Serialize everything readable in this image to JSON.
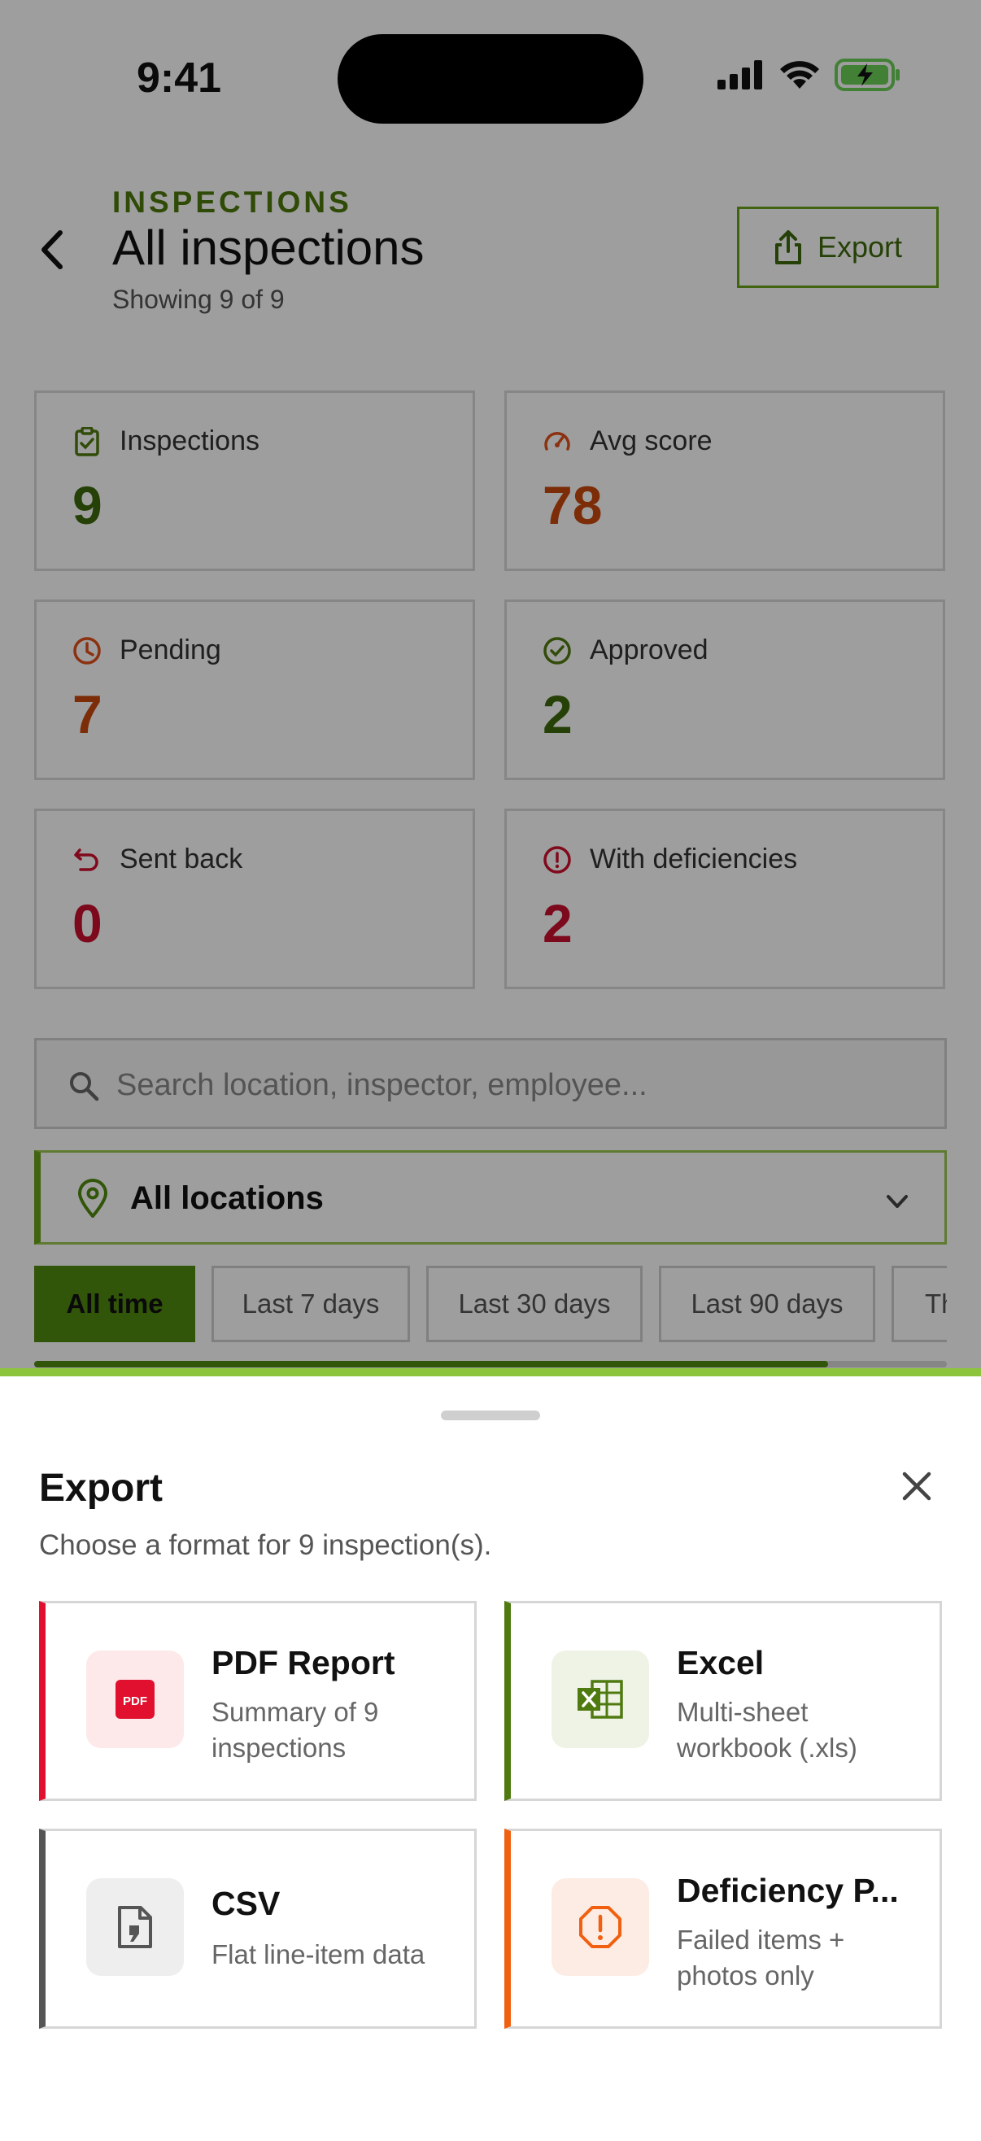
{
  "status_bar": {
    "time": "9:41"
  },
  "header": {
    "eyebrow": "INSPECTIONS",
    "title": "All inspections",
    "subtitle": "Showing 9 of 9",
    "export_label": "Export"
  },
  "stats": [
    {
      "label": "Inspections",
      "value": "9",
      "icon": "clipboard-check-icon",
      "color": "#3e6a0c"
    },
    {
      "label": "Avg score",
      "value": "78",
      "icon": "gauge-icon",
      "color": "#c8480c"
    },
    {
      "label": "Pending",
      "value": "7",
      "icon": "clock-icon",
      "color": "#c8480c"
    },
    {
      "label": "Approved",
      "value": "2",
      "icon": "check-circle-icon",
      "color": "#3e6a0c"
    },
    {
      "label": "Sent back",
      "value": "0",
      "icon": "undo-icon",
      "color": "#c8102e"
    },
    {
      "label": "With deficiencies",
      "value": "2",
      "icon": "alert-circle-icon",
      "color": "#c8102e"
    }
  ],
  "search": {
    "placeholder": "Search location, inspector, employee..."
  },
  "location_filter": {
    "value": "All locations"
  },
  "date_chips": [
    {
      "label": "All time",
      "active": true
    },
    {
      "label": "Last 7 days",
      "active": false
    },
    {
      "label": "Last 30 days",
      "active": false
    },
    {
      "label": "Last 90 days",
      "active": false
    },
    {
      "label": "Th",
      "active": false
    }
  ],
  "scroll_progress": 0.87,
  "export_sheet": {
    "title": "Export",
    "subtitle": "Choose a format for 9 inspection(s).",
    "options": [
      {
        "title": "PDF Report",
        "desc": "Summary of 9 inspections",
        "icon": "pdf-icon",
        "accent": "#e0102e"
      },
      {
        "title": "Excel",
        "desc": "Multi-sheet workbook (.xls)",
        "icon": "excel-icon",
        "accent": "#4f7a10"
      },
      {
        "title": "CSV",
        "desc": "Flat line-item data",
        "icon": "csv-file-icon",
        "accent": "#555555"
      },
      {
        "title": "Deficiency P...",
        "desc": "Failed items + photos only",
        "icon": "alert-octagon-icon",
        "accent": "#f06010"
      }
    ]
  }
}
